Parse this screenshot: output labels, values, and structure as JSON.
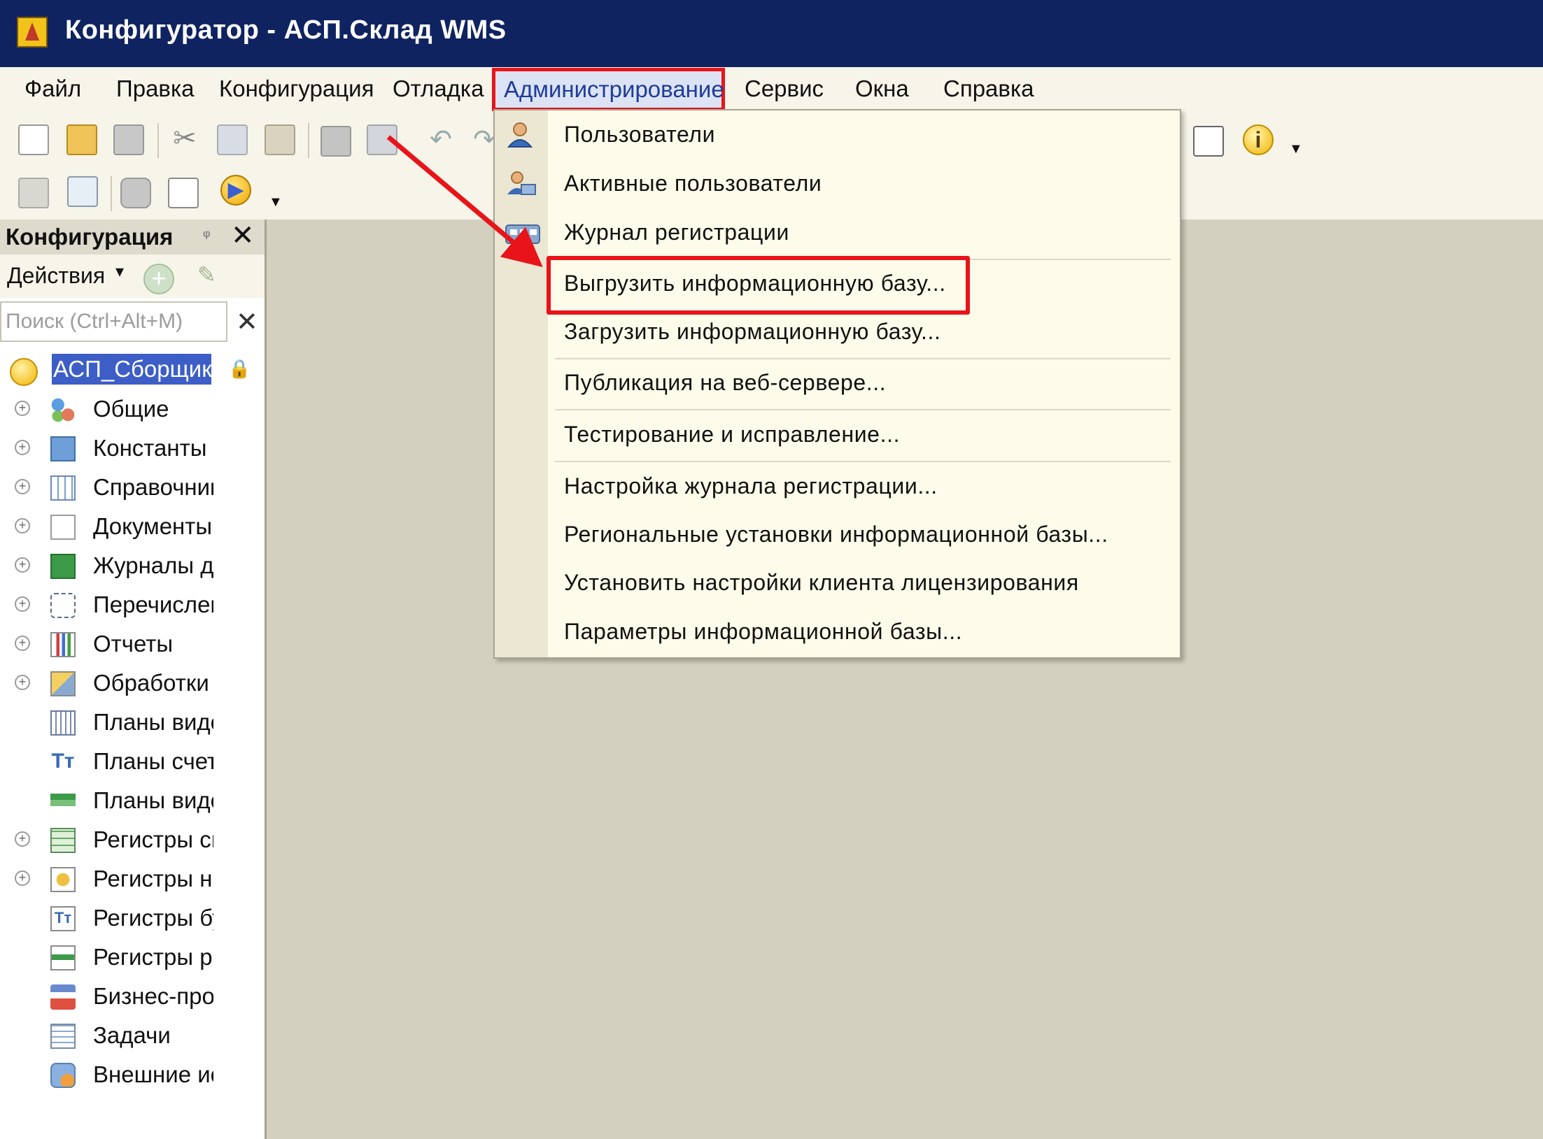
{
  "window": {
    "title": "Конфигуратор - АСП.Склад WMS"
  },
  "menubar": {
    "items": [
      {
        "label": "Файл"
      },
      {
        "label": "Правка"
      },
      {
        "label": "Конфигурация"
      },
      {
        "label": "Отладка"
      },
      {
        "label": "Администрирование"
      },
      {
        "label": "Сервис"
      },
      {
        "label": "Окна"
      },
      {
        "label": "Справка"
      }
    ],
    "active": "Администрирование"
  },
  "toolbar": {
    "icons": [
      "new-document-icon",
      "open-icon",
      "save-icon",
      "cut-icon",
      "copy-icon",
      "paste-icon",
      "print-icon",
      "preview-icon",
      "undo-icon",
      "redo-icon",
      "syntax-help-icon",
      "info-icon",
      "config-tree-icon",
      "compare-icon",
      "database-icon",
      "table-icon",
      "run-debug-icon"
    ]
  },
  "panel": {
    "title": "Конфигурация",
    "actions_label": "Действия",
    "search_placeholder": "Поиск (Ctrl+Alt+M)",
    "root": "АСП_СборщикТ",
    "tree": [
      {
        "label": "Общие",
        "icon": "common-icon",
        "expandable": true
      },
      {
        "label": "Константы",
        "icon": "constants-icon",
        "expandable": true
      },
      {
        "label": "Справочники",
        "icon": "catalogs-icon",
        "expandable": true
      },
      {
        "label": "Документы",
        "icon": "documents-icon",
        "expandable": true
      },
      {
        "label": "Журналы документов",
        "icon": "journals-icon",
        "expandable": true
      },
      {
        "label": "Перечисления",
        "icon": "enums-icon",
        "expandable": true
      },
      {
        "label": "Отчеты",
        "icon": "reports-icon",
        "expandable": true
      },
      {
        "label": "Обработки",
        "icon": "processors-icon",
        "expandable": true
      },
      {
        "label": "Планы видов характеристик",
        "icon": "chart-of-characteristic-types-icon",
        "expandable": false
      },
      {
        "label": "Планы счетов",
        "icon": "chart-of-accounts-icon",
        "expandable": false
      },
      {
        "label": "Планы видов расчета",
        "icon": "chart-of-calculation-types-icon",
        "expandable": false
      },
      {
        "label": "Регистры сведений",
        "icon": "info-registers-icon",
        "expandable": true
      },
      {
        "label": "Регистры накопления",
        "icon": "accumulation-registers-icon",
        "expandable": true
      },
      {
        "label": "Регистры бухгалтерии",
        "icon": "accounting-registers-icon",
        "expandable": false
      },
      {
        "label": "Регистры расчета",
        "icon": "calculation-registers-icon",
        "expandable": false
      },
      {
        "label": "Бизнес-процессы",
        "icon": "business-processes-icon",
        "expandable": false
      },
      {
        "label": "Задачи",
        "icon": "tasks-icon",
        "expandable": false
      },
      {
        "label": "Внешние источники данных",
        "icon": "external-sources-icon",
        "expandable": false
      }
    ]
  },
  "admin_menu": {
    "items": [
      {
        "label": "Пользователи",
        "icon": "users-icon"
      },
      {
        "label": "Активные пользователи",
        "icon": "active-users-icon"
      },
      {
        "label": "Журнал регистрации",
        "icon": "event-log-icon"
      },
      {
        "label": "Выгрузить информационную базу...",
        "icon": ""
      },
      {
        "label": "Загрузить информационную базу...",
        "icon": ""
      },
      {
        "label": "Публикация на веб-сервере...",
        "icon": ""
      },
      {
        "label": "Тестирование и исправление...",
        "icon": ""
      },
      {
        "label": "Настройка журнала регистрации...",
        "icon": ""
      },
      {
        "label": "Региональные установки информационной базы...",
        "icon": ""
      },
      {
        "label": "Установить настройки клиента лицензирования",
        "icon": ""
      },
      {
        "label": "Параметры информационной базы...",
        "icon": ""
      }
    ],
    "highlighted": "Выгрузить информационную базу..."
  },
  "colors": {
    "titlebar": "#0f2361",
    "menubar": "#f7f5e9",
    "workspace": "#d4d0bf",
    "annotation": "#e8141a",
    "selection": "#3d5ec7"
  }
}
